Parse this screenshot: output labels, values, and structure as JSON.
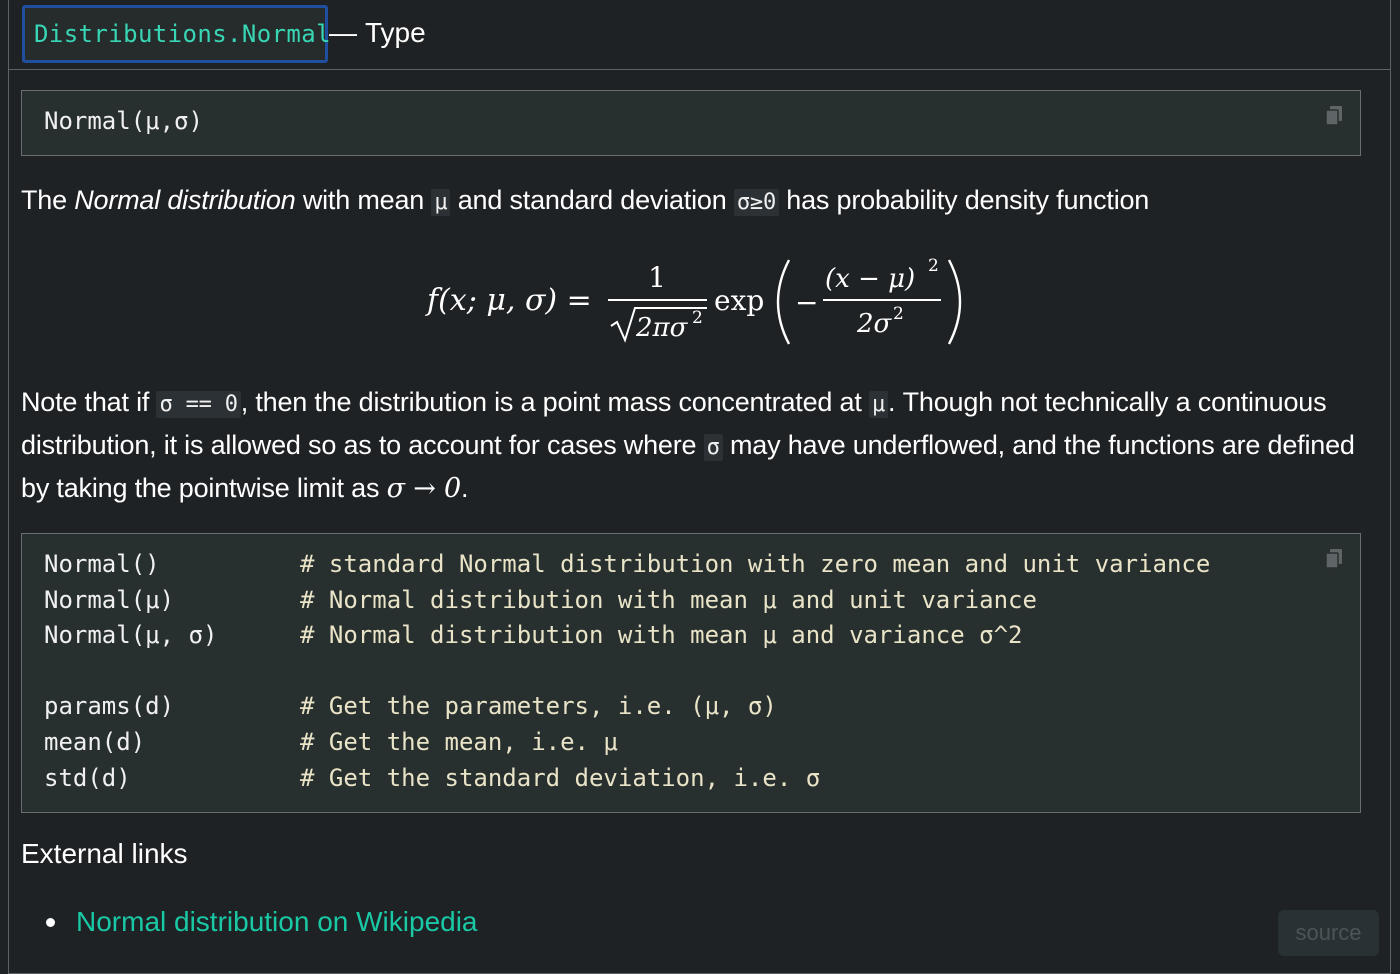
{
  "header": {
    "binding": "Distributions.Normal",
    "dash": "—",
    "category": "Type"
  },
  "signature": {
    "code": "Normal(μ,σ)"
  },
  "description": {
    "part1": "The ",
    "emphasis": "Normal distribution",
    "part2": " with mean ",
    "code_mu": "μ",
    "part3": " and standard deviation ",
    "code_sigma": "σ≥0",
    "part4": " has probability density function"
  },
  "formula": {
    "lhs": "f(x; μ, σ) =",
    "frac1_num": "1",
    "frac1_den": "2πσ",
    "exp": "exp",
    "minus": "−",
    "frac2_num": "(x − μ)",
    "frac2_den": "2σ",
    "sup": "2"
  },
  "note": {
    "t1": "Note that if ",
    "c1": "σ == 0",
    "t2": ", then the distribution is a point mass concentrated at ",
    "c2": "μ",
    "t3": ". Though not technically a continuous distribution, it is allowed so as to account for cases where ",
    "c3": "σ",
    "t4": " may have underflowed, and the functions are defined by taking the pointwise limit as ",
    "math": "σ → 0",
    "t5": "."
  },
  "usage": {
    "lines": [
      {
        "call": "Normal()",
        "comment": "# standard Normal distribution with zero mean and unit variance"
      },
      {
        "call": "Normal(μ)",
        "comment": "# Normal distribution with mean μ and unit variance"
      },
      {
        "call": "Normal(μ, σ)",
        "comment": "# Normal distribution with mean μ and variance σ^2"
      },
      {
        "call": "params(d)",
        "comment": "# Get the parameters, i.e. (μ, σ)"
      },
      {
        "call": "mean(d)",
        "comment": "# Get the mean, i.e. μ"
      },
      {
        "call": "std(d)",
        "comment": "# Get the standard deviation, i.e. σ"
      }
    ]
  },
  "external": {
    "heading": "External links",
    "links": [
      {
        "label": "Normal distribution on Wikipedia"
      }
    ]
  },
  "source_button": "source",
  "icons": {
    "copy": "copy-icon"
  },
  "colors": {
    "background": "#1f2224",
    "link": "#19c8a5",
    "binding_text": "#38d6b4",
    "binding_border": "#1f4f9e",
    "comment": "#e9e4c7"
  }
}
